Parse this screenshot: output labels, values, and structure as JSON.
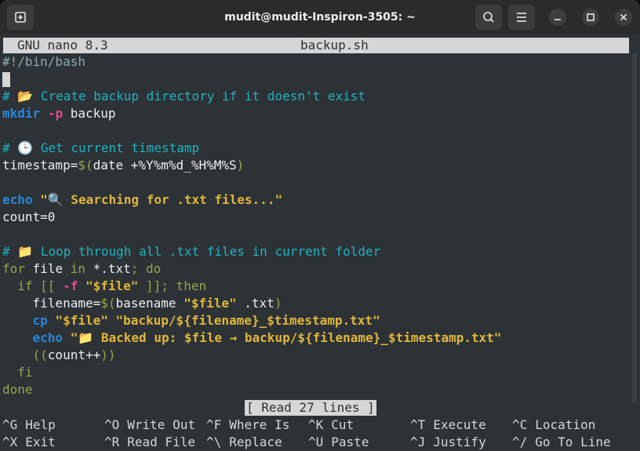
{
  "window": {
    "title": "mudit@mudit-Inspiron-3505: ~"
  },
  "titlebar": {
    "newtab_icon": "new-tab-icon",
    "search_icon": "search-icon",
    "menu_icon": "hamburger-menu-icon",
    "minimize_icon": "minimize-icon",
    "maximize_icon": "maximize-icon",
    "close_icon": "close-icon"
  },
  "nano": {
    "name": "GNU nano 8.3",
    "filename": "backup.sh",
    "status": "[ Read 27 lines ]",
    "lines": {
      "l1": "#!/bin/bash",
      "l3": "# 📂 Create backup directory if it doesn't exist",
      "l4_cmd": "mkdir",
      "l4_opt": "-p",
      "l4_rest": " backup",
      "l6": "# 🕒 Get current timestamp",
      "l7_a": "timestamp=",
      "l7_b": "$(",
      "l7_c": "date +%Y%m%d_%H%M%S",
      "l7_d": ")",
      "l9_cmd": "echo",
      "l9_str": "\"🔍 Searching for .txt files...\"",
      "l10_a": "count=",
      "l10_b": "0",
      "l12": "# 📁 Loop through all .txt files in current folder",
      "l13_for": "for",
      "l13_a": " file ",
      "l13_in": "in",
      "l13_b": " *.txt",
      "l13_semi": "; ",
      "l13_do": "do",
      "l14_if": "  if [[ ",
      "l14_opt": "-f",
      "l14_str": " \"$file\"",
      "l14_rest": " ]]; then",
      "l15_a": "    filename=",
      "l15_b": "$(",
      "l15_c": "basename ",
      "l15_str": "\"$file\"",
      "l15_d": " .txt",
      "l15_e": ")",
      "l16_cmd": "    cp",
      "l16_str": " \"$file\" \"backup/${filename}_$timestamp.txt\"",
      "l17_cmd": "    echo",
      "l17_q": " \"",
      "l17_str": "📁 Backed up: $file → backup/${filename}_$timestamp.txt\"",
      "l18_a": "    ((",
      "l18_b": "count++",
      "l18_c": "))",
      "l19": "  fi",
      "l20": "done"
    }
  },
  "shortcuts": {
    "row1": [
      {
        "key": "^G",
        "label": "Help"
      },
      {
        "key": "^O",
        "label": "Write Out"
      },
      {
        "key": "^F",
        "label": "Where Is"
      },
      {
        "key": "^K",
        "label": "Cut"
      },
      {
        "key": "^T",
        "label": "Execute"
      },
      {
        "key": "^C",
        "label": "Location"
      }
    ],
    "row2": [
      {
        "key": "^X",
        "label": "Exit"
      },
      {
        "key": "^R",
        "label": "Read File"
      },
      {
        "key": "^\\",
        "label": "Replace"
      },
      {
        "key": "^U",
        "label": "Paste"
      },
      {
        "key": "^J",
        "label": "Justify"
      },
      {
        "key": "^/",
        "label": "Go To Line"
      }
    ]
  }
}
